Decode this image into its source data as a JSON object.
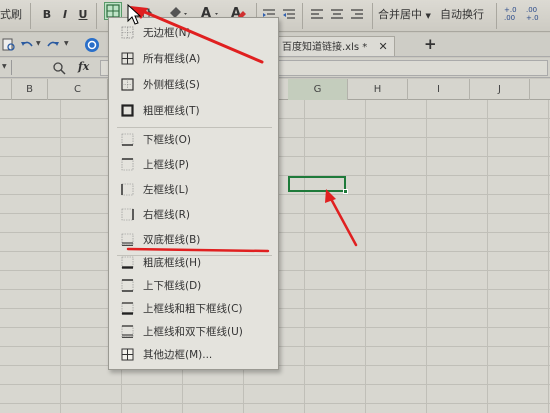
{
  "ribbon": {
    "left_label": "式刷",
    "bold": "B",
    "italic": "I",
    "underline": "U",
    "merge_center": "合并居中",
    "wrap_text": "自动换行",
    "decimal_top": "+.0 .00",
    "decimal_bottom": ".00 +.0"
  },
  "tab": {
    "filename": "百度知道链接.xls *",
    "new_tab": "+"
  },
  "formula": {
    "fx": "fx"
  },
  "columns": [
    "B",
    "C",
    "G",
    "H",
    "I",
    "J"
  ],
  "menu": {
    "items": [
      {
        "label": "无边框(N)"
      },
      {
        "label": "所有框线(A)"
      },
      {
        "label": "外侧框线(S)"
      },
      {
        "label": "粗匣框线(T)"
      },
      {
        "label": "下框线(O)"
      },
      {
        "label": "上框线(P)"
      },
      {
        "label": "左框线(L)"
      },
      {
        "label": "右框线(R)"
      },
      {
        "label": "双底框线(B)"
      },
      {
        "label": "粗底框线(H)"
      },
      {
        "label": "上下框线(D)"
      },
      {
        "label": "上框线和粗下框线(C)"
      },
      {
        "label": "上框线和双下框线(U)"
      },
      {
        "label": "其他边框(M)..."
      }
    ]
  },
  "colors": {
    "annotation_red": "#e02020",
    "selection_green": "#1e7a3a",
    "font_red": "#d01010",
    "fill_yellow": "#f2d200"
  }
}
